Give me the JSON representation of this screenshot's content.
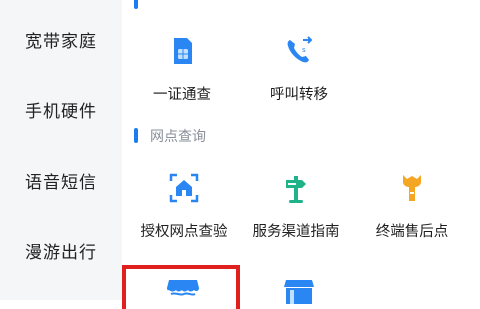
{
  "sidebar": {
    "items": [
      {
        "label": "宽带家庭"
      },
      {
        "label": "手机硬件"
      },
      {
        "label": "语音短信"
      },
      {
        "label": "漫游出行"
      }
    ]
  },
  "sections": [
    {
      "title": "",
      "items": [
        {
          "label": "一证通查",
          "icon": "sim-card-icon"
        },
        {
          "label": "呼叫转移",
          "icon": "call-forward-icon"
        }
      ]
    },
    {
      "title": "网点查询",
      "items": [
        {
          "label": "授权网点查验",
          "icon": "store-scan-icon"
        },
        {
          "label": "服务渠道指南",
          "icon": "signpost-icon"
        },
        {
          "label": "终端售后点",
          "icon": "wrench-icon"
        }
      ]
    }
  ],
  "colors": {
    "accent": "#1a7cf0",
    "green": "#1fb38a",
    "orange": "#f5a623",
    "highlight": "#e0201c"
  }
}
